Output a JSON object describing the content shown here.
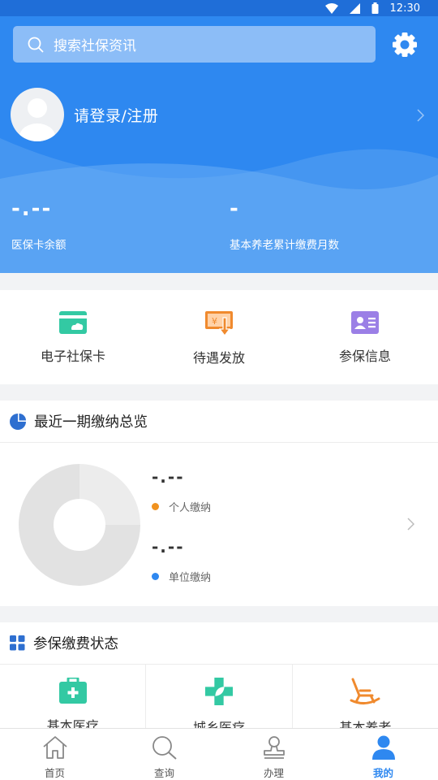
{
  "status_bar": {
    "time": "12:30",
    "icons": [
      "wifi-icon",
      "signal-icon",
      "battery-icon"
    ]
  },
  "header": {
    "search_placeholder": "搜索社保资讯",
    "settings_icon": "gear-icon",
    "login_text": "请登录/注册"
  },
  "stats": [
    {
      "value": "-.--",
      "label": "医保卡余额"
    },
    {
      "value": "-",
      "label": "基本养老累计缴费月数"
    }
  ],
  "quick_actions": [
    {
      "label": "电子社保卡",
      "icon": "card-icon",
      "color": "#33c9a3"
    },
    {
      "label": "待遇发放",
      "icon": "payment-icon",
      "color": "#f08a2e"
    },
    {
      "label": "参保信息",
      "icon": "id-card-icon",
      "color": "#9b7fe6"
    }
  ],
  "summary": {
    "title": "最近一期缴纳总览",
    "personal_amount": "-.--",
    "personal_label": "个人缴纳",
    "personal_color": "#f0921f",
    "unit_amount": "-.--",
    "unit_label": "单位缴纳",
    "unit_color": "#2e88f0"
  },
  "status_section": {
    "title": "参保缴费状态",
    "items": [
      {
        "label": "基本医疗",
        "icon": "medical-kit-icon",
        "color": "#33c9a3"
      },
      {
        "label": "城乡医疗",
        "icon": "medical-cross-icon",
        "color": "#33c9a3"
      },
      {
        "label": "基本养老",
        "icon": "rocking-chair-icon",
        "color": "#f08a2e"
      }
    ]
  },
  "bottom_nav": [
    {
      "label": "首页",
      "icon": "home-icon",
      "active": false
    },
    {
      "label": "查询",
      "icon": "search-icon",
      "active": false
    },
    {
      "label": "办理",
      "icon": "stamp-icon",
      "active": false
    },
    {
      "label": "我的",
      "icon": "user-icon",
      "active": true
    }
  ],
  "colors": {
    "primary": "#2e88f0",
    "statusbar": "#1f6ed8"
  }
}
